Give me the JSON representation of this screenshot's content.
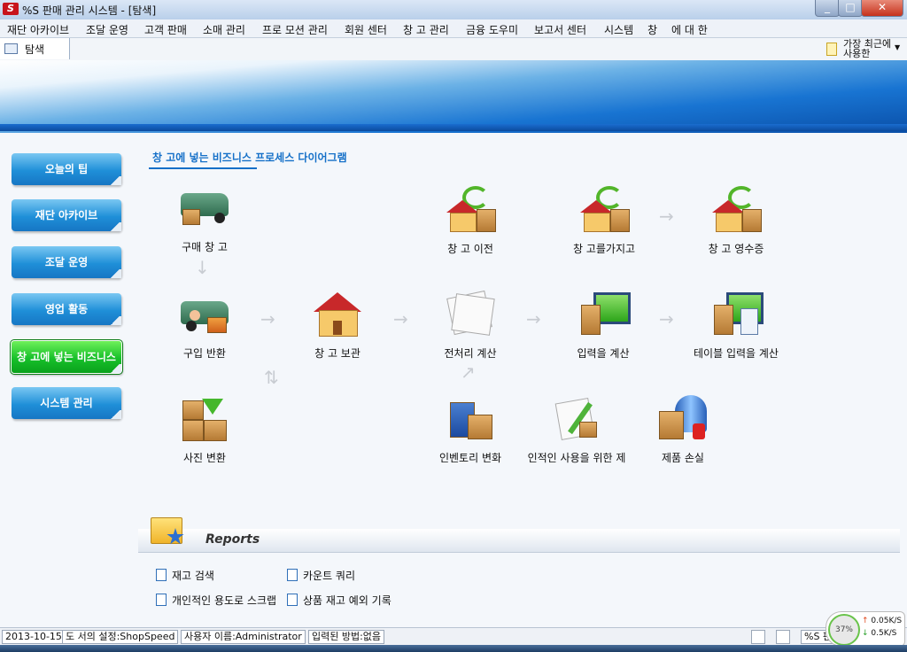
{
  "window": {
    "title": "%S 판매 관리 시스템 - [탐색]",
    "logo_text": "S",
    "minimize": "_",
    "maximize": "□",
    "close": "✕"
  },
  "menu": [
    "재단 아카이브",
    "조달 운영",
    "고객 판매",
    "소매 관리",
    "프로 모션 관리",
    "회원 센터",
    "창 고 관리",
    "금융 도우미",
    "보고서 센터",
    "시스템",
    "창",
    "에 대 한"
  ],
  "tab": {
    "label": "탐색"
  },
  "recent": {
    "label": "가장 최근에 사용한",
    "arrow": "▼"
  },
  "sidebar": [
    {
      "label": "오늘의 팁",
      "active": false
    },
    {
      "label": "재단 아카이브",
      "active": false
    },
    {
      "label": "조달 운영",
      "active": false
    },
    {
      "label": "영업 활동",
      "active": false
    },
    {
      "label": "창 고에 넣는 비즈니스",
      "active": true
    },
    {
      "label": "시스템 관리",
      "active": false
    }
  ],
  "diagram": {
    "title": "창 고에 넣는 비즈니스 프로세스 다이어그램",
    "nodes": {
      "purchase_warehouse": "구매 창 고",
      "purchase_return": "구입 반환",
      "photo_convert": "사진 변환",
      "warehouse_storage": "창 고 보관",
      "warehouse_transfer": "창 고 이전",
      "preprocess_calc": "전처리 계산",
      "inventory_change": "인벤토리 변화",
      "personal_use": "인적인 사용을 위한 제",
      "warehouse_take": "창 고를가지고",
      "input_calc": "입력을 계산",
      "product_loss": "제품 손실",
      "warehouse_receipt": "창 고 영수증",
      "table_input_calc": "테이블 입력을 계산"
    },
    "arrow_right": "→",
    "arrow_down": "↓",
    "arrow_swap": "⇅",
    "arrow_diag": "↗"
  },
  "reports": {
    "title": "Reports",
    "links": [
      "재고 검색",
      "카운트 쿼리",
      "개인적인 용도로 스크랩",
      "상품 재고 예외 기록"
    ]
  },
  "status": {
    "date": "2013-10-15",
    "settings": "도 서의 설정:ShopSpeed",
    "user": "사용자 이름:Administrator",
    "input_method": "입력된 방법:없음",
    "app_short": "%S 판"
  },
  "network": {
    "percent": "37%",
    "up": "0.05K/S",
    "down": "0.5K/S",
    "up_arrow": "↑",
    "down_arrow": "↓"
  }
}
